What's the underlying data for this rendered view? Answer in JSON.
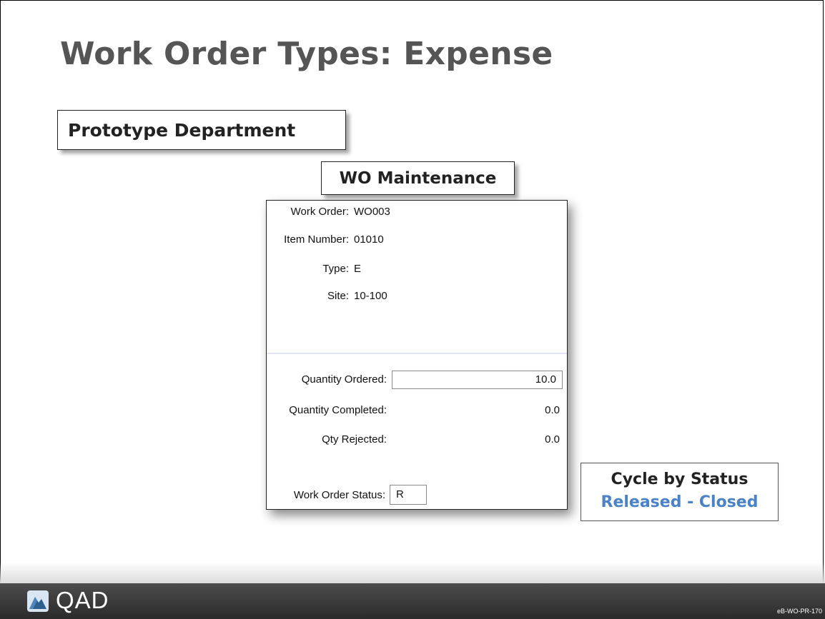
{
  "slide": {
    "title": "Work Order Types: Expense",
    "department_label": "Prototype Department",
    "panel_heading": "WO Maintenance"
  },
  "wo_form": {
    "work_order": {
      "label": "Work Order:",
      "value": "WO003"
    },
    "item_number": {
      "label": "Item Number:",
      "value": "01010"
    },
    "type": {
      "label": "Type:",
      "value": "E"
    },
    "site": {
      "label": "Site:",
      "value": "10-100"
    },
    "quantity_ordered": {
      "label": "Quantity Ordered:",
      "value": "10.0"
    },
    "quantity_completed": {
      "label": "Quantity Completed:",
      "value": "0.0"
    },
    "qty_rejected": {
      "label": "Qty Rejected:",
      "value": "0.0"
    },
    "work_order_status": {
      "label": "Work Order Status:",
      "value": "R"
    }
  },
  "cycle": {
    "heading": "Cycle by Status",
    "values": "Released - Closed",
    "value_color": "#4a82c8"
  },
  "footer": {
    "logo_text": "QAD",
    "slide_code": "eB-WO-PR-170"
  }
}
